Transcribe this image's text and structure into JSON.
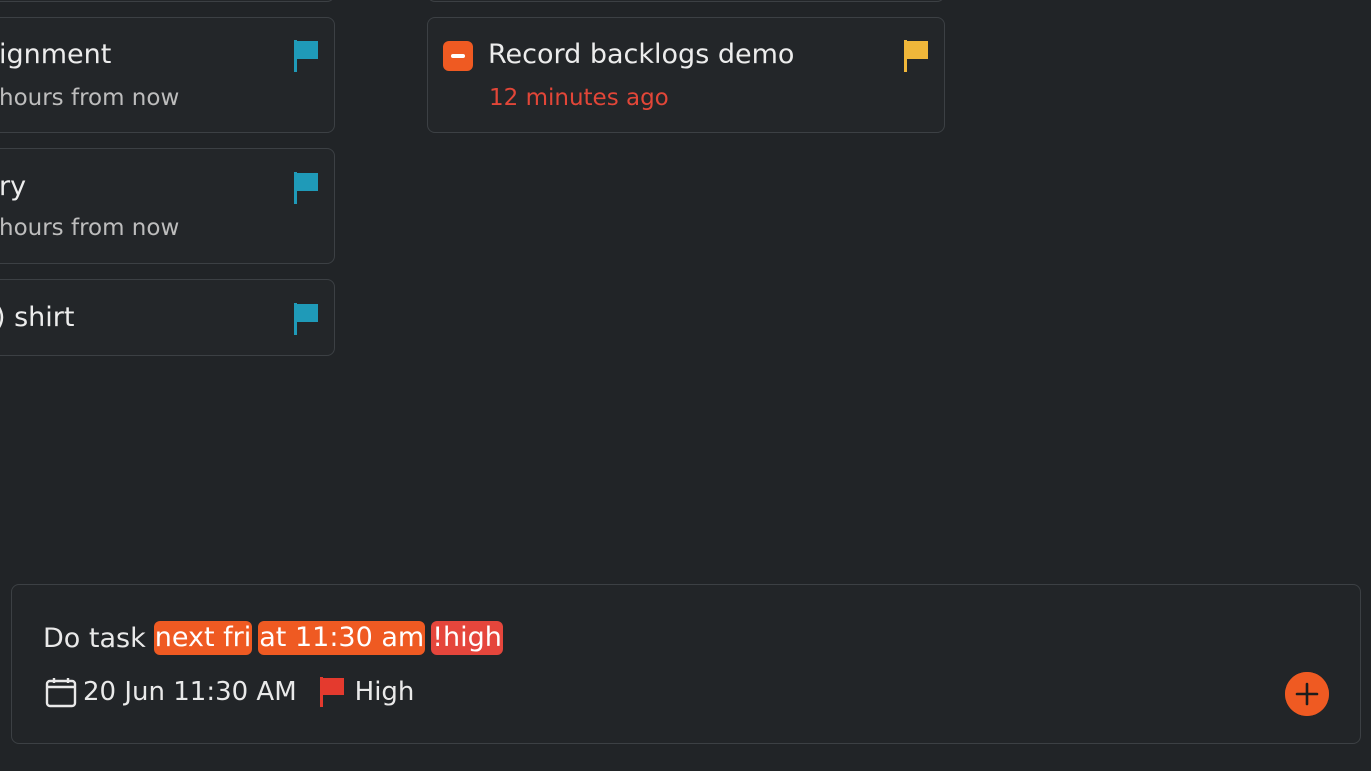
{
  "colors": {
    "background": "#212427",
    "card_border": "#3c4044",
    "accent_orange": "#ef5a22",
    "overdue_red": "#e24638",
    "flag_teal": "#1f9ab8",
    "flag_yellow": "#f0b73a",
    "flag_red": "#e43a2e",
    "token_red": "#e5463c"
  },
  "left_column": {
    "cards": [
      {
        "title": "ignment",
        "subtitle": "hours from now",
        "flag_icon": "flag-icon",
        "flag_color": "#1f9ab8"
      },
      {
        "title": "ry",
        "subtitle": "hours from now",
        "flag_icon": "flag-icon",
        "flag_color": "#1f9ab8"
      },
      {
        "title": ") shirt",
        "flag_icon": "flag-icon",
        "flag_color": "#1f9ab8"
      }
    ]
  },
  "right_column": {
    "cards": [
      {
        "title": "Record backlogs demo",
        "subtitle": "12 minutes ago",
        "checkbox_icon": "minus-checkbox-icon",
        "flag_icon": "flag-icon",
        "flag_color": "#f0b73a"
      }
    ]
  },
  "composer": {
    "text": "Do task",
    "tokens": [
      {
        "text": "next fri",
        "color": "#ef5a22"
      },
      {
        "text": "at 11:30 am",
        "color": "#ef5a22"
      },
      {
        "text": "!high",
        "color": "#e5463c"
      }
    ],
    "date_icon": "calendar-icon",
    "date_label": "20 Jun 11:30 AM",
    "priority_icon": "flag-icon",
    "priority_label": "High",
    "add_icon": "plus-circle-icon"
  }
}
